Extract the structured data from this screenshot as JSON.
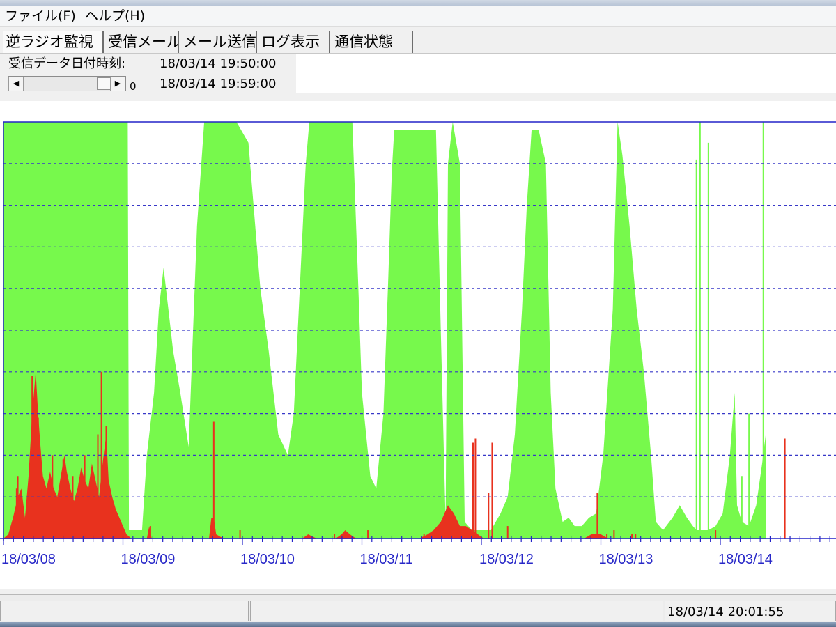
{
  "menu": {
    "file": "ファイル(F)",
    "help": "ヘルプ(H)"
  },
  "tabs": [
    {
      "label": "逆ラジオ監視",
      "active": true
    },
    {
      "label": "受信メール",
      "active": false
    },
    {
      "label": "メール送信",
      "active": false
    },
    {
      "label": "ログ表示",
      "active": false
    },
    {
      "label": "通信状態",
      "active": false
    }
  ],
  "info": {
    "label": "受信データ日付時刻:",
    "time_start": "18/03/14 19:50:00",
    "time_end": "18/03/14 19:59:00",
    "scroll_value": "0",
    "scroll_position": 0.85
  },
  "chart_data": {
    "type": "area",
    "title": "",
    "xlabel": "",
    "ylabel": "",
    "x_ticks": [
      "18/03/08",
      "18/03/09",
      "18/03/10",
      "18/03/11",
      "18/03/12",
      "18/03/13",
      "18/03/14"
    ],
    "x_range_days": [
      0,
      6.6
    ],
    "ylim": [
      0,
      1
    ],
    "grid": "horizontal dashed, 9 lines",
    "colors": {
      "green": "#77f94c",
      "red": "#e8321e",
      "grid": "#3838c8",
      "axis": "#2424c8",
      "tick_text": "#2828c8"
    },
    "series": [
      {
        "color": "green",
        "points": [
          [
            0.0,
            1.0
          ],
          [
            1.04,
            1.0
          ],
          [
            1.05,
            0.02
          ],
          [
            1.16,
            0.02
          ],
          [
            1.2,
            0.2
          ],
          [
            1.26,
            0.35
          ],
          [
            1.3,
            0.55
          ],
          [
            1.34,
            0.65
          ],
          [
            1.38,
            0.55
          ],
          [
            1.42,
            0.45
          ],
          [
            1.48,
            0.35
          ],
          [
            1.55,
            0.22
          ],
          [
            1.58,
            0.45
          ],
          [
            1.62,
            0.75
          ],
          [
            1.68,
            1.0
          ],
          [
            1.95,
            1.0
          ],
          [
            2.05,
            0.95
          ],
          [
            2.15,
            0.6
          ],
          [
            2.22,
            0.45
          ],
          [
            2.3,
            0.25
          ],
          [
            2.38,
            0.2
          ],
          [
            2.43,
            0.3
          ],
          [
            2.48,
            0.6
          ],
          [
            2.53,
            0.9
          ],
          [
            2.56,
            1.0
          ],
          [
            2.92,
            1.0
          ],
          [
            2.97,
            0.6
          ],
          [
            3.0,
            0.35
          ],
          [
            3.07,
            0.15
          ],
          [
            3.12,
            0.12
          ],
          [
            3.18,
            0.3
          ],
          [
            3.22,
            0.62
          ],
          [
            3.25,
            0.88
          ],
          [
            3.27,
            0.98
          ],
          [
            3.62,
            0.98
          ],
          [
            3.66,
            0.5
          ],
          [
            3.7,
            0.04
          ],
          [
            3.72,
            0.9
          ],
          [
            3.76,
            1.0
          ],
          [
            3.82,
            0.9
          ],
          [
            3.86,
            0.04
          ],
          [
            3.92,
            0.02
          ],
          [
            4.08,
            0.02
          ],
          [
            4.1,
            0.03
          ],
          [
            4.16,
            0.06
          ],
          [
            4.22,
            0.1
          ],
          [
            4.28,
            0.25
          ],
          [
            4.34,
            0.55
          ],
          [
            4.38,
            0.8
          ],
          [
            4.42,
            0.98
          ],
          [
            4.48,
            0.98
          ],
          [
            4.54,
            0.9
          ],
          [
            4.58,
            0.35
          ],
          [
            4.62,
            0.12
          ],
          [
            4.68,
            0.04
          ],
          [
            4.73,
            0.05
          ],
          [
            4.78,
            0.03
          ],
          [
            4.84,
            0.03
          ],
          [
            4.9,
            0.05
          ],
          [
            4.96,
            0.06
          ],
          [
            5.02,
            0.2
          ],
          [
            5.1,
            0.55
          ],
          [
            5.14,
            1.0
          ],
          [
            5.18,
            0.92
          ],
          [
            5.24,
            0.75
          ],
          [
            5.3,
            0.55
          ],
          [
            5.36,
            0.4
          ],
          [
            5.42,
            0.2
          ],
          [
            5.46,
            0.04
          ],
          [
            5.52,
            0.02
          ],
          [
            5.6,
            0.05
          ],
          [
            5.66,
            0.08
          ],
          [
            5.72,
            0.05
          ],
          [
            5.77,
            0.03
          ],
          [
            5.8,
            0.02
          ],
          [
            5.85,
            0.02
          ],
          [
            5.9,
            0.02
          ],
          [
            5.96,
            0.03
          ],
          [
            6.02,
            0.06
          ],
          [
            6.08,
            0.2
          ],
          [
            6.12,
            0.35
          ],
          [
            6.14,
            0.08
          ],
          [
            6.18,
            0.04
          ],
          [
            6.24,
            0.03
          ],
          [
            6.3,
            0.08
          ],
          [
            6.35,
            0.18
          ],
          [
            6.38,
            0.25
          ]
        ]
      },
      {
        "color": "red",
        "points": [
          [
            0.0,
            0.0
          ],
          [
            0.04,
            0.01
          ],
          [
            0.08,
            0.05
          ],
          [
            0.12,
            0.1
          ],
          [
            0.15,
            0.12
          ],
          [
            0.18,
            0.05
          ],
          [
            0.21,
            0.15
          ],
          [
            0.24,
            0.3
          ],
          [
            0.27,
            0.4
          ],
          [
            0.29,
            0.3
          ],
          [
            0.31,
            0.22
          ],
          [
            0.33,
            0.15
          ],
          [
            0.36,
            0.12
          ],
          [
            0.39,
            0.16
          ],
          [
            0.42,
            0.12
          ],
          [
            0.45,
            0.1
          ],
          [
            0.48,
            0.15
          ],
          [
            0.51,
            0.2
          ],
          [
            0.53,
            0.16
          ],
          [
            0.56,
            0.12
          ],
          [
            0.59,
            0.09
          ],
          [
            0.62,
            0.12
          ],
          [
            0.65,
            0.17
          ],
          [
            0.68,
            0.14
          ],
          [
            0.71,
            0.12
          ],
          [
            0.74,
            0.18
          ],
          [
            0.77,
            0.14
          ],
          [
            0.8,
            0.1
          ],
          [
            0.83,
            0.18
          ],
          [
            0.86,
            0.25
          ],
          [
            0.88,
            0.14
          ],
          [
            0.91,
            0.1
          ],
          [
            0.94,
            0.07
          ],
          [
            0.97,
            0.05
          ],
          [
            1.0,
            0.03
          ],
          [
            1.03,
            0.01
          ],
          [
            1.07,
            0.0
          ],
          [
            1.2,
            0.0
          ],
          [
            1.22,
            0.03
          ],
          [
            1.24,
            0.0
          ],
          [
            1.65,
            0.0
          ],
          [
            1.72,
            0.0
          ],
          [
            1.74,
            0.05
          ],
          [
            1.76,
            0.05
          ],
          [
            1.78,
            0.01
          ],
          [
            1.84,
            0.0
          ],
          [
            2.5,
            0.0
          ],
          [
            2.55,
            0.01
          ],
          [
            2.62,
            0.0
          ],
          [
            2.78,
            0.0
          ],
          [
            2.83,
            0.01
          ],
          [
            2.86,
            0.02
          ],
          [
            2.9,
            0.01
          ],
          [
            2.95,
            0.0
          ],
          [
            3.48,
            0.0
          ],
          [
            3.55,
            0.01
          ],
          [
            3.6,
            0.02
          ],
          [
            3.66,
            0.04
          ],
          [
            3.72,
            0.08
          ],
          [
            3.77,
            0.06
          ],
          [
            3.82,
            0.03
          ],
          [
            3.87,
            0.03
          ],
          [
            3.92,
            0.02
          ],
          [
            3.97,
            0.01
          ],
          [
            4.02,
            0.0
          ],
          [
            4.86,
            0.0
          ],
          [
            4.92,
            0.01
          ],
          [
            5.0,
            0.01
          ],
          [
            5.06,
            0.0
          ],
          [
            6.6,
            0.0
          ]
        ]
      }
    ],
    "spikes": [
      {
        "color": "red",
        "points": [
          [
            0.11,
            0.12
          ],
          [
            0.12,
            0.15
          ],
          [
            0.24,
            0.39
          ],
          [
            0.29,
            0.29
          ],
          [
            0.33,
            0.11
          ],
          [
            0.41,
            0.2
          ],
          [
            0.5,
            0.19
          ],
          [
            0.58,
            0.15
          ],
          [
            0.68,
            0.2
          ],
          [
            0.79,
            0.25
          ],
          [
            0.82,
            0.4
          ],
          [
            0.86,
            0.27
          ],
          [
            1.23,
            0.03
          ],
          [
            1.76,
            0.28
          ],
          [
            1.98,
            0.02
          ],
          [
            2.77,
            0.01
          ],
          [
            3.05,
            0.02
          ],
          [
            3.52,
            0.01
          ],
          [
            3.93,
            0.23
          ],
          [
            3.95,
            0.24
          ],
          [
            4.06,
            0.11
          ],
          [
            4.09,
            0.23
          ],
          [
            4.22,
            0.03
          ],
          [
            4.97,
            0.11
          ],
          [
            5.05,
            0.01
          ],
          [
            5.11,
            0.02
          ],
          [
            5.26,
            0.01
          ],
          [
            5.29,
            0.01
          ],
          [
            5.96,
            0.02
          ],
          [
            6.54,
            0.24
          ]
        ]
      },
      {
        "color": "green",
        "points": [
          [
            5.8,
            0.91
          ],
          [
            5.83,
            1.0
          ],
          [
            5.9,
            0.95
          ],
          [
            6.18,
            0.15
          ],
          [
            6.24,
            0.3
          ],
          [
            6.36,
            1.0
          ]
        ]
      }
    ]
  },
  "status": {
    "time": "18/03/14 20:01:55"
  }
}
